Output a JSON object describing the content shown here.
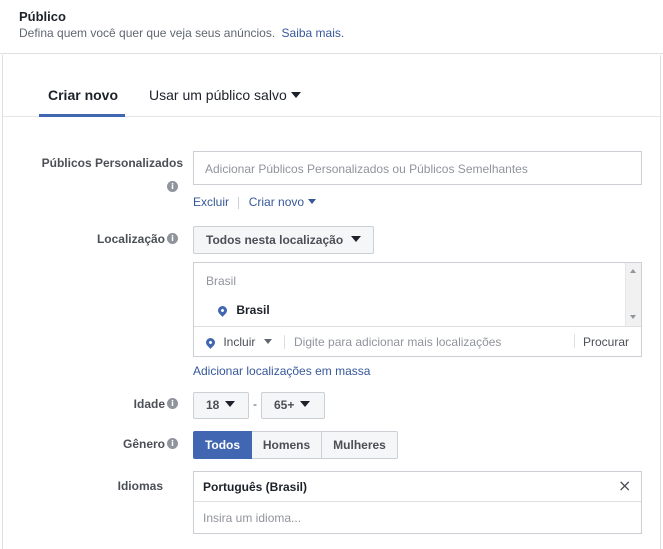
{
  "header": {
    "title": "Público",
    "description": "Defina quem você quer que veja seus anúncios.",
    "learn_more": "Saiba mais."
  },
  "tabs": [
    {
      "label": "Criar novo",
      "active": true
    },
    {
      "label": "Usar um público salvo",
      "active": false
    }
  ],
  "custom_audiences": {
    "label": "Públicos Personalizados",
    "placeholder": "Adicionar Públicos Personalizados ou Públicos Semelhantes",
    "exclude_link": "Excluir",
    "create_link": "Criar novo"
  },
  "location": {
    "label": "Localização",
    "scope_button": "Todos nesta localização",
    "group_header": "Brasil",
    "selected": "Brasil",
    "include_select": "Incluir",
    "search_placeholder": "Digite para adicionar mais localizações",
    "browse": "Procurar",
    "bulk_link": "Adicionar localizações em massa"
  },
  "age": {
    "label": "Idade",
    "min": "18",
    "separator": "-",
    "max": "65+"
  },
  "gender": {
    "label": "Gênero",
    "options": [
      "Todos",
      "Homens",
      "Mulheres"
    ],
    "selected": "Todos"
  },
  "languages": {
    "label": "Idiomas",
    "selected": "Português (Brasil)",
    "placeholder": "Insira um idioma..."
  },
  "colors": {
    "accent": "#4267b2",
    "link": "#365899",
    "border": "#ccd0d5",
    "muted": "#90949c"
  },
  "icons": {
    "info": "info-icon",
    "pin": "location-pin-icon",
    "remove": "close-icon",
    "dropdown": "caret-down-icon"
  }
}
